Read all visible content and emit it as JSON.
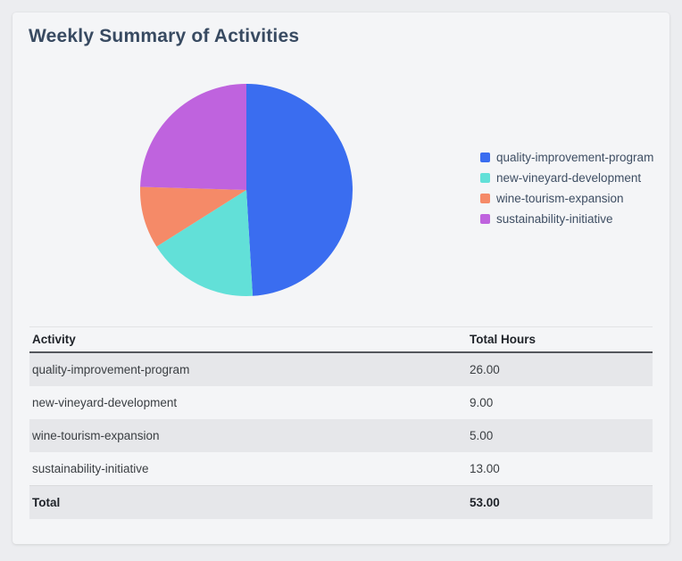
{
  "card": {
    "title": "Weekly Summary of Activities"
  },
  "chart_data": {
    "type": "pie",
    "title": "Weekly Summary of Activities",
    "labels": [
      "quality-improvement-program",
      "new-vineyard-development",
      "wine-tourism-expansion",
      "sustainability-initiative"
    ],
    "values": [
      26,
      9,
      5,
      13
    ],
    "total": 53,
    "colors": [
      "#3a6df0",
      "#62e0d8",
      "#f58a68",
      "#bf63de"
    ],
    "start_angle_deg": 0,
    "direction": "clockwise",
    "legend_position": "right"
  },
  "table": {
    "columns": [
      "Activity",
      "Total Hours"
    ],
    "rows": [
      {
        "activity": "quality-improvement-program",
        "hours": "26.00"
      },
      {
        "activity": "new-vineyard-development",
        "hours": "9.00"
      },
      {
        "activity": "wine-tourism-expansion",
        "hours": "5.00"
      },
      {
        "activity": "sustainability-initiative",
        "hours": "13.00"
      }
    ],
    "total": {
      "label": "Total",
      "hours": "53.00"
    }
  }
}
